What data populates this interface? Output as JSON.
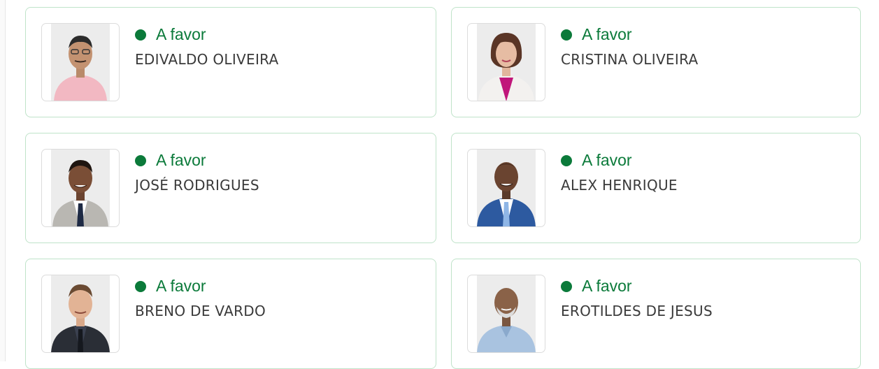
{
  "vote_color": "#0b7a3a",
  "card_border_color": "#bfe3c9",
  "members": [
    {
      "vote": "A favor",
      "name": "EDIVALDO OLIVEIRA",
      "photo": "portrait-man-pink-shirt"
    },
    {
      "vote": "A favor",
      "name": "CRISTINA OLIVEIRA",
      "photo": "portrait-woman-white-blazer"
    },
    {
      "vote": "A favor",
      "name": "JOSÉ RODRIGUES",
      "photo": "portrait-man-gray-suit"
    },
    {
      "vote": "A favor",
      "name": "ALEX HENRIQUE",
      "photo": "portrait-man-blue-suit"
    },
    {
      "vote": "A favor",
      "name": "BRENO DE VARDO",
      "photo": "portrait-man-dark-suit"
    },
    {
      "vote": "A favor",
      "name": "EROTILDES DE JESUS",
      "photo": "portrait-man-light-blue-shirt"
    }
  ]
}
